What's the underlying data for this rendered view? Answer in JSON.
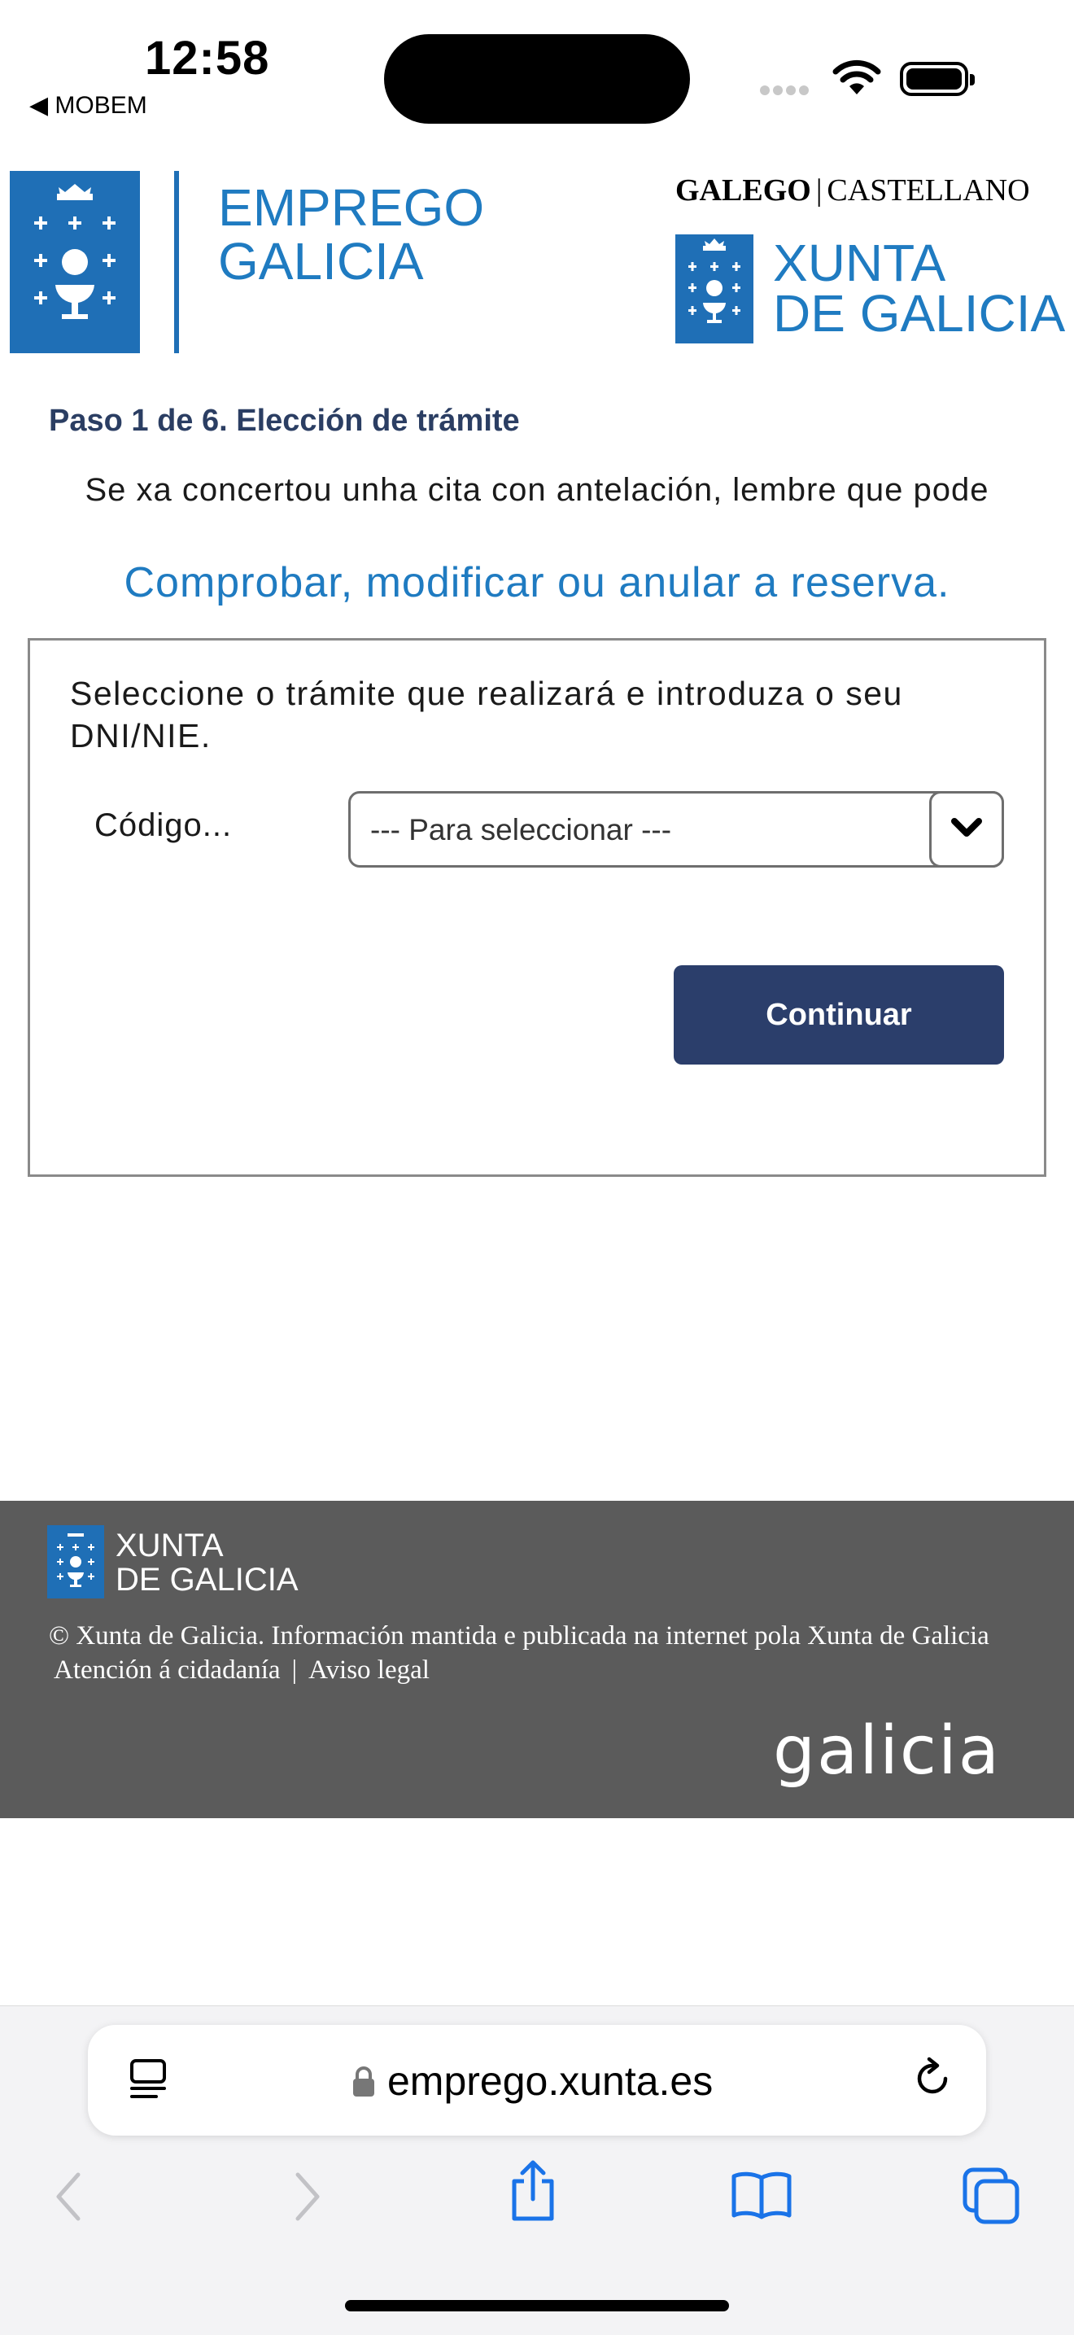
{
  "status_bar": {
    "time": "12:58",
    "back_app": "◀ MOBEM"
  },
  "header": {
    "emprego_line1": "EMPREGO",
    "emprego_line2": "GALICIA",
    "lang_galego": "GALEGO",
    "lang_sep": "|",
    "lang_castellano": "CASTELLANO",
    "xunta_line1": "XUNTA",
    "xunta_line2": "DE GALICIA"
  },
  "main": {
    "step_title": "Paso 1 de 6. Elección de trámite",
    "intro_text": "Se xa concertou unha cita con antelación, lembre que pode",
    "manage_link": "Comprobar, modificar ou anular a reserva",
    "manage_link_period": ".",
    "panel_instruction": "Seleccione o trámite que realizará e introduza o seu DNI/NIE.",
    "code_label": "Código...",
    "select_value": "--- Para seleccionar ---",
    "continue_label": "Continuar"
  },
  "footer": {
    "xunta_line1": "XUNTA",
    "xunta_line2": "DE GALICIA",
    "copyright": "© Xunta de Galicia. Información mantida e publicada na internet pola Xunta de Galicia",
    "link_citizen": "Atención á cidadanía",
    "link_sep": "|",
    "link_legal": "Aviso legal",
    "brand": "galicia"
  },
  "browser": {
    "url": "emprego.xunta.es"
  },
  "colors": {
    "brand_blue": "#1f6fb6",
    "link_blue": "#1f7bc1",
    "button_navy": "#2b3e6b",
    "footer_grey": "#5b5b5b"
  },
  "icons": [
    "wifi-icon",
    "battery-icon",
    "chevron-down-icon",
    "lock-icon",
    "reader-icon",
    "reload-icon",
    "back-arrow-icon",
    "forward-arrow-icon",
    "share-icon",
    "bookmarks-icon",
    "tabs-icon"
  ]
}
